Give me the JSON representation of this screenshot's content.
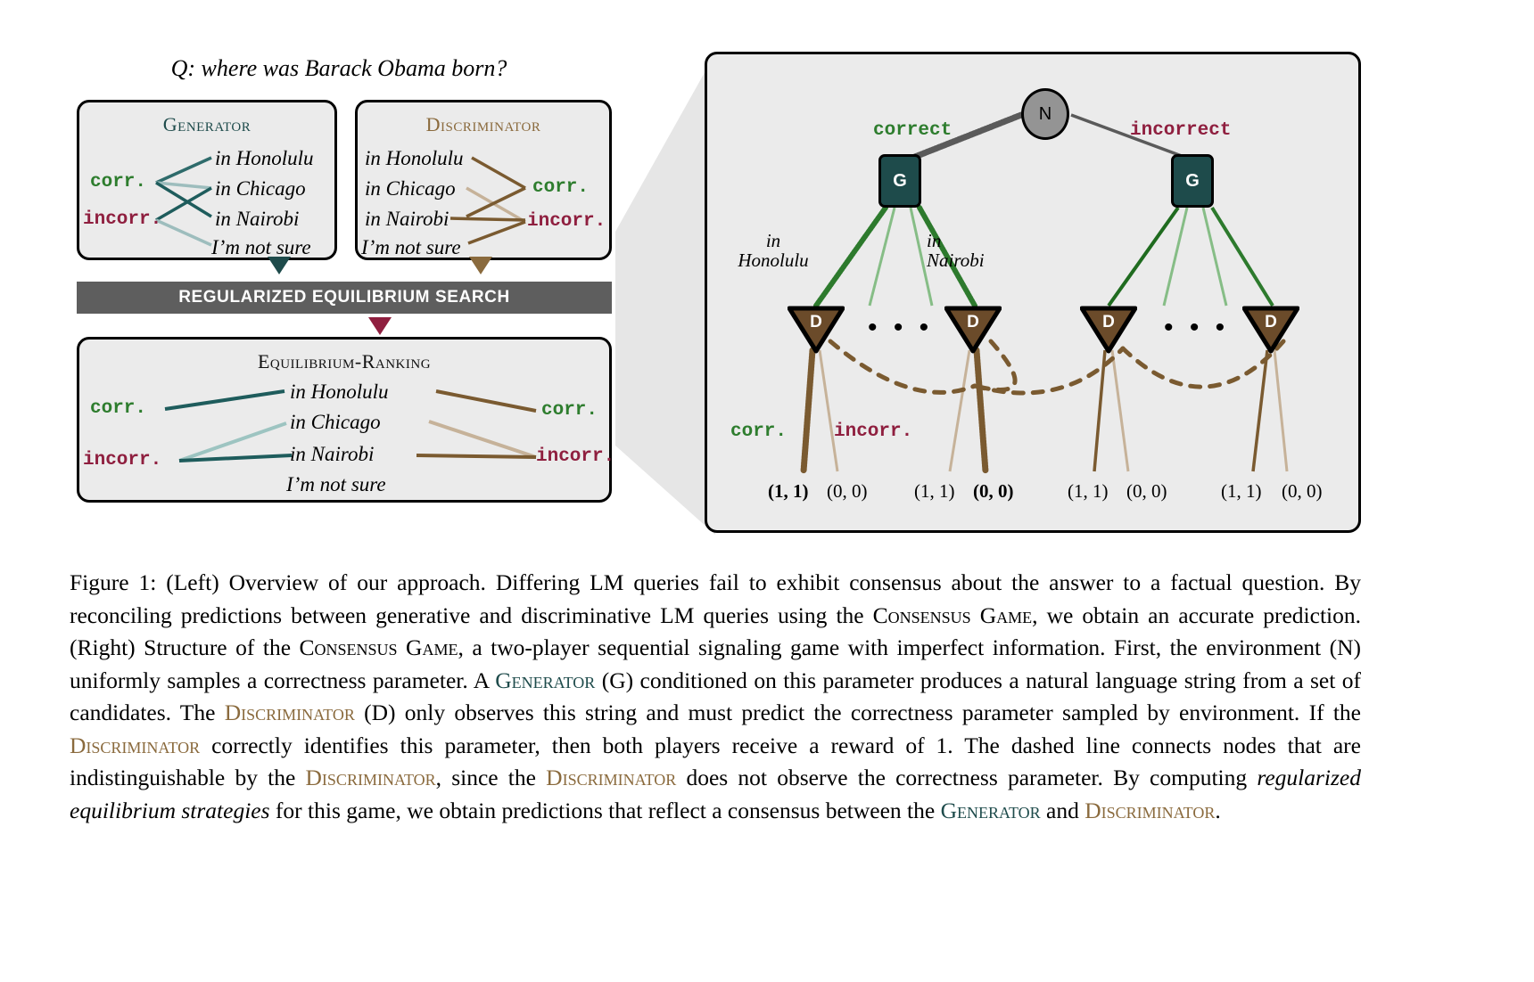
{
  "figure": {
    "question": "Q: where was Barack Obama born?",
    "candidates": [
      "in Honolulu",
      "in Chicago",
      "in Nairobi",
      "I’m not sure"
    ],
    "labels": {
      "correct_short": "corr.",
      "incorrect_short": "incorr."
    },
    "colors": {
      "generator": "#1e4b4b",
      "discriminator": "#8a6a3d",
      "correct_green": "#2e7d2e",
      "incorrect_red": "#8f1f3f",
      "panel_bg": "#ebebeb",
      "bar_bg": "#5e5e5e",
      "nature_node": "#949494"
    },
    "panels": {
      "generator": {
        "title": "Generator"
      },
      "discriminator": {
        "title": "Discriminator"
      },
      "equilibrium": {
        "title": "Equilibrium-Ranking"
      }
    },
    "search_bar": {
      "label": "REGULARIZED EQUILIBRIUM SEARCH"
    }
  },
  "tree": {
    "nature_node": "N",
    "generator_node": "G",
    "discriminator_node": "D",
    "branch_left": "correct",
    "branch_right": "incorrect",
    "message_left": "in\nHonolulu",
    "message_left_line1": "in",
    "message_left_line2": "Honolulu",
    "message_right_line1": "in",
    "message_right_line2": "Nairobi",
    "action_correct": "corr.",
    "action_incorrect": "incorr.",
    "ellipsis": "• • •",
    "payoffs": [
      {
        "value": "(1, 1)",
        "bold": true
      },
      {
        "value": "(0, 0)",
        "bold": false
      },
      {
        "value": "(1, 1)",
        "bold": false
      },
      {
        "value": "(0, 0)",
        "bold": true
      },
      {
        "value": "(1, 1)",
        "bold": false
      },
      {
        "value": "(0, 0)",
        "bold": false
      },
      {
        "value": "(1, 1)",
        "bold": false
      },
      {
        "value": "(0, 0)",
        "bold": false
      }
    ]
  },
  "caption": {
    "figure_number": "Figure 1:",
    "text_part_1": " (Left) Overview of our approach. Differing LM queries fail to exhibit consensus about the answer to a factual question. By reconciling predictions between generative and discriminative LM queries using the ",
    "term_consensus_game": "Consensus Game",
    "text_part_2": ", we obtain an accurate prediction. (Right) Structure of the ",
    "term_consensus_game_2": "Consensus Game",
    "text_part_3": ", a two-player sequential signaling game with imperfect information. First, the environment (N) uniformly samples a correctness parameter. A ",
    "term_generator": "Generator",
    "text_part_4": " (G) conditioned on this parameter produces a natural language string from a set of candidates. The ",
    "term_discriminator": "Discriminator",
    "text_part_5": " (D) only observes this string and must predict the correctness parameter sampled by environment. If the ",
    "term_discriminator_2": "Discriminator",
    "text_part_6": " correctly identifies this parameter, then both players receive a reward of 1. The dashed line connects nodes that are indistinguishable by the ",
    "term_discriminator_3": "Discriminator",
    "text_part_7": ", since the ",
    "term_discriminator_4": "Discriminator",
    "text_part_8": " does not observe the correctness parameter. By computing ",
    "term_italic": "regularized equilibrium strategies",
    "text_part_9": " for this game, we obtain predictions that reflect a consensus between the ",
    "term_generator_2": "Generator",
    "text_part_10": " and ",
    "term_discriminator_5": "Discriminator",
    "text_part_11": "."
  }
}
